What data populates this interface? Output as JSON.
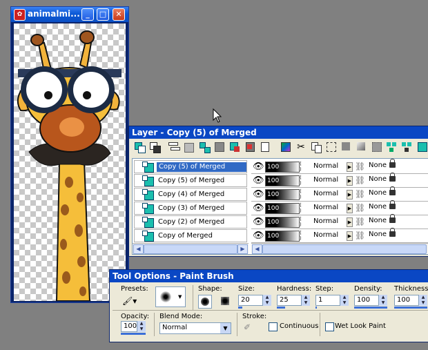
{
  "image_window": {
    "title": "animalmi...",
    "minimize": "_",
    "maximize": "□",
    "close": "✕"
  },
  "layer_palette": {
    "title": "Layer - Copy (5) of Merged",
    "layers": [
      {
        "name": "Copy (5) of Merged",
        "opacity": "100",
        "blend": "Normal",
        "link": "None",
        "selected": true
      },
      {
        "name": "Copy (5) of Merged",
        "opacity": "100",
        "blend": "Normal",
        "link": "None",
        "selected": false
      },
      {
        "name": "Copy (4) of Merged",
        "opacity": "100",
        "blend": "Normal",
        "link": "None",
        "selected": false
      },
      {
        "name": "Copy (3) of Merged",
        "opacity": "100",
        "blend": "Normal",
        "link": "None",
        "selected": false
      },
      {
        "name": "Copy (2) of Merged",
        "opacity": "100",
        "blend": "Normal",
        "link": "None",
        "selected": false
      },
      {
        "name": "Copy of Merged",
        "opacity": "100",
        "blend": "Normal",
        "link": "None",
        "selected": false
      }
    ]
  },
  "tool_options": {
    "title": "Tool Options - Paint Brush",
    "presets_label": "Presets:",
    "shape_label": "Shape:",
    "size_label": "Size:",
    "size_value": "20",
    "hardness_label": "Hardness:",
    "hardness_value": "25",
    "step_label": "Step:",
    "step_value": "1",
    "density_label": "Density:",
    "density_value": "100",
    "thickness_label": "Thickness:",
    "thickness_value": "100",
    "opacity_label": "Opacity:",
    "opacity_value": "100",
    "blend_label": "Blend Mode:",
    "blend_value": "Normal",
    "stroke_label": "Stroke:",
    "continuous_label": "Continuous",
    "wet_label": "Wet Look Paint"
  },
  "colors": {
    "desktop": "#808080",
    "title_bar": "#0a47c4",
    "panel": "#ece9d8",
    "selection": "#316ac5"
  }
}
